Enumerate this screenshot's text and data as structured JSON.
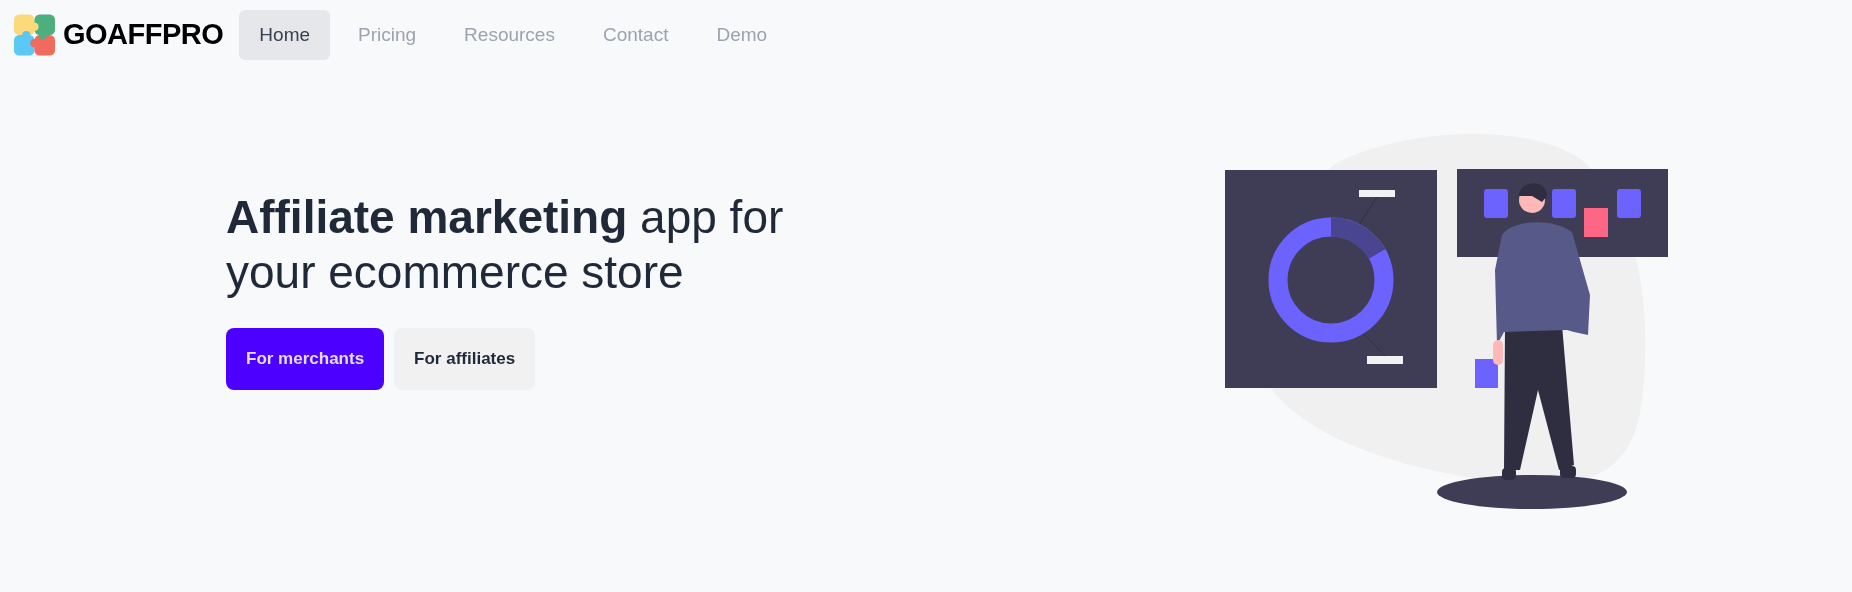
{
  "logo": {
    "text": "GOAFFPRO"
  },
  "nav": [
    {
      "label": "Home",
      "selected": true
    },
    {
      "label": "Pricing",
      "selected": false
    },
    {
      "label": "Resources",
      "selected": false
    },
    {
      "label": "Contact",
      "selected": false
    },
    {
      "label": "Demo",
      "selected": false
    }
  ],
  "hero": {
    "headline": "**Affiliate marketing** app for your ecommerce store",
    "buttons": [
      {
        "label": "For merchants",
        "kind": "primary"
      },
      {
        "label": "For affiliates",
        "kind": "secondary"
      }
    ]
  }
}
